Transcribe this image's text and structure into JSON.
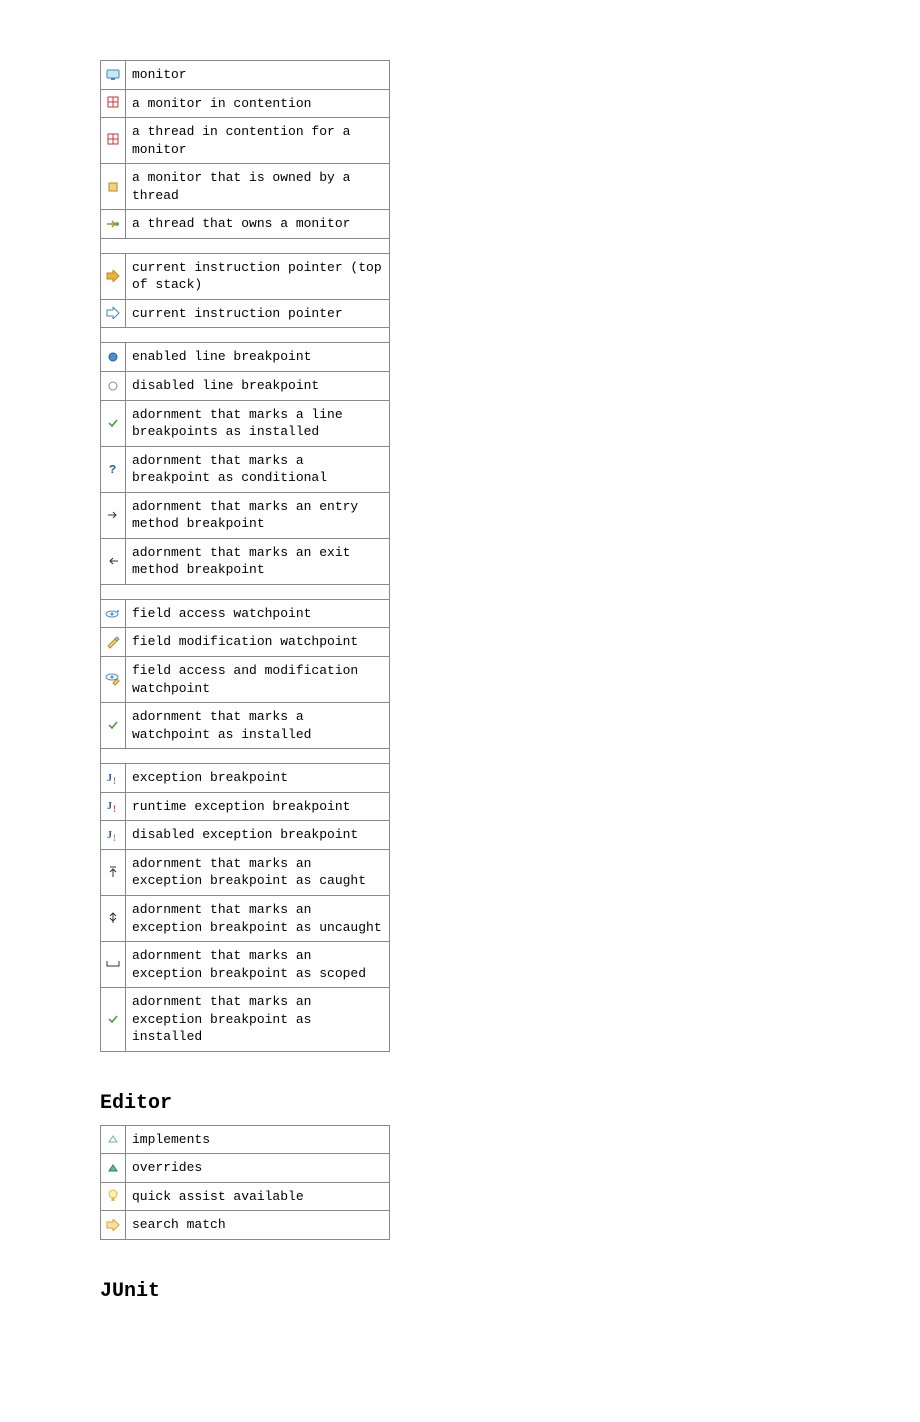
{
  "debug_table": {
    "rows": [
      {
        "icon": "monitor",
        "label": "monitor"
      },
      {
        "icon": "monitor-contention",
        "label": "a monitor in contention"
      },
      {
        "icon": "thread-contention",
        "label": "a thread in contention for a monitor"
      },
      {
        "icon": "monitor-owned",
        "label": "a monitor that is owned by a thread"
      },
      {
        "icon": "thread-owns",
        "label": "a thread that owns a monitor"
      },
      {
        "spacer": true
      },
      {
        "icon": "ip-top",
        "label": "current instruction pointer (top of stack)"
      },
      {
        "icon": "ip",
        "label": "current instruction pointer"
      },
      {
        "spacer": true
      },
      {
        "icon": "bp-enabled",
        "label": "enabled line breakpoint"
      },
      {
        "icon": "bp-disabled",
        "label": "disabled line breakpoint"
      },
      {
        "icon": "adorn-installed",
        "label": "adornment that marks a line breakpoints as installed"
      },
      {
        "icon": "adorn-conditional",
        "label": "adornment that marks a breakpoint as conditional"
      },
      {
        "icon": "adorn-entry",
        "label": "adornment that marks an entry method breakpoint"
      },
      {
        "icon": "adorn-exit",
        "label": "adornment that marks an exit method breakpoint"
      },
      {
        "spacer": true
      },
      {
        "icon": "watch-access",
        "label": "field access watchpoint"
      },
      {
        "icon": "watch-modify",
        "label": "field modification watchpoint"
      },
      {
        "icon": "watch-both",
        "label": "field access and modification watchpoint"
      },
      {
        "icon": "adorn-watch-installed",
        "label": "adornment that marks a watchpoint as installed"
      },
      {
        "spacer": true
      },
      {
        "icon": "exc-bp",
        "label": "exception breakpoint"
      },
      {
        "icon": "exc-bp-runtime",
        "label": "runtime exception breakpoint"
      },
      {
        "icon": "exc-bp-disabled",
        "label": "disabled exception breakpoint"
      },
      {
        "icon": "adorn-caught",
        "label": "adornment that marks an exception breakpoint as caught"
      },
      {
        "icon": "adorn-uncaught",
        "label": "adornment that marks an exception breakpoint as uncaught"
      },
      {
        "icon": "adorn-scoped",
        "label": "adornment that marks an exception breakpoint as scoped"
      },
      {
        "icon": "adorn-exc-installed",
        "label": "adornment that marks an exception breakpoint as installed"
      }
    ]
  },
  "headings": {
    "editor": "Editor",
    "junit": "JUnit"
  },
  "editor_table": {
    "rows": [
      {
        "icon": "implements",
        "label": "implements"
      },
      {
        "icon": "overrides",
        "label": "overrides"
      },
      {
        "icon": "quickassist",
        "label": "quick assist available"
      },
      {
        "icon": "searchmatch",
        "label": "search match"
      }
    ]
  }
}
